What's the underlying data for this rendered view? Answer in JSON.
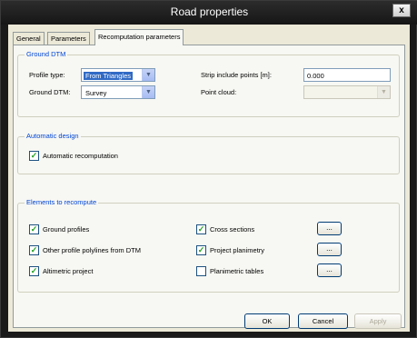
{
  "window": {
    "title": "Road properties",
    "close_label": "x"
  },
  "tabs": [
    {
      "label": "General"
    },
    {
      "label": "Parameters"
    },
    {
      "label": "Recomputation parameters"
    }
  ],
  "ground_dtm": {
    "title": "Ground DTM",
    "profile_type_label": "Profile type:",
    "profile_type_value": "From Triangles",
    "ground_dtm_label": "Ground DTM:",
    "ground_dtm_value": "Survey",
    "strip_label": "Strip include points [m]:",
    "strip_value": "0.000",
    "point_cloud_label": "Point cloud:",
    "point_cloud_value": ""
  },
  "automatic_design": {
    "title": "Automatic design",
    "auto_recomputation_label": "Automatic recomputation",
    "auto_recomputation_checked": true
  },
  "elements": {
    "title": "Elements to recompute",
    "items": [
      {
        "label": "Ground profiles",
        "checked": true
      },
      {
        "label": "Other profile polylines from DTM",
        "checked": true
      },
      {
        "label": "Altimetric project",
        "checked": true
      },
      {
        "label": "Cross sections",
        "checked": true
      },
      {
        "label": "Project planimetry",
        "checked": true
      },
      {
        "label": "Planimetric tables",
        "checked": false
      }
    ],
    "more_label": "..."
  },
  "buttons": {
    "ok": "OK",
    "cancel": "Cancel",
    "apply": "Apply"
  },
  "check_glyph": "✓",
  "arrow_glyph": "▼"
}
